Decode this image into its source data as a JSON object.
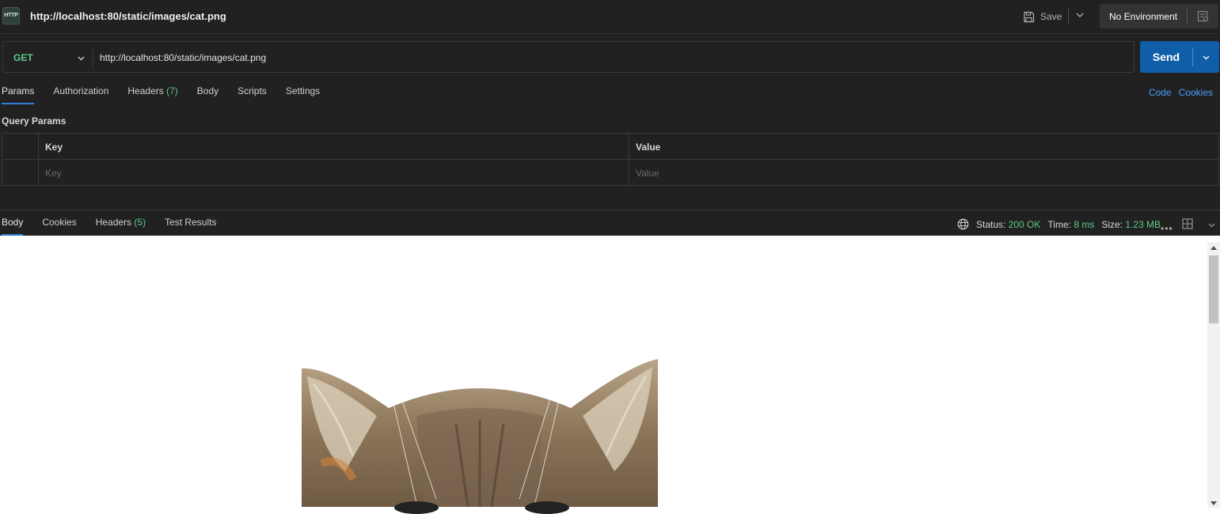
{
  "titlebar": {
    "icon_text": "HTTP",
    "title": "http://localhost:80/static/images/cat.png",
    "save_label": "Save",
    "environment": "No Environment"
  },
  "request": {
    "method": "GET",
    "url": "http://localhost:80/static/images/cat.png",
    "send_label": "Send"
  },
  "request_tabs": [
    {
      "label": "Params",
      "count": ""
    },
    {
      "label": "Authorization",
      "count": ""
    },
    {
      "label": "Headers",
      "count": "(7)"
    },
    {
      "label": "Body",
      "count": ""
    },
    {
      "label": "Scripts",
      "count": ""
    },
    {
      "label": "Settings",
      "count": ""
    }
  ],
  "links": {
    "code": "Code",
    "cookies": "Cookies"
  },
  "query_params": {
    "title": "Query Params",
    "columns": [
      "Key",
      "Value"
    ],
    "placeholders": {
      "key": "Key",
      "value": "Value"
    }
  },
  "response_tabs": [
    {
      "label": "Body",
      "count": ""
    },
    {
      "label": "Cookies",
      "count": ""
    },
    {
      "label": "Headers",
      "count": "(5)"
    },
    {
      "label": "Test Results",
      "count": ""
    }
  ],
  "response_status": {
    "status_label": "Status:",
    "status_value": "200 OK",
    "time_label": "Time:",
    "time_value": "8 ms",
    "size_label": "Size:",
    "size_value": "1.23 MB"
  },
  "colors": {
    "accent": "#0f5fa8",
    "success": "#5cc98a",
    "link": "#4a9eff"
  }
}
